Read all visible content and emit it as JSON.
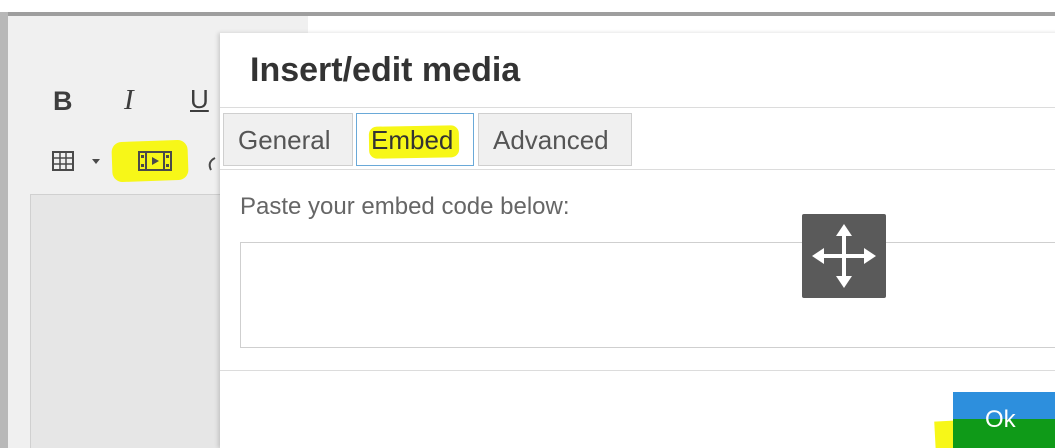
{
  "editor": {
    "toolbar": {
      "bold_label": "B",
      "italic_label": "I",
      "underline_label": "U"
    },
    "icons": {
      "bold": "bold-icon",
      "italic": "italic-icon",
      "underline": "underline-icon",
      "table": "table-grid-icon",
      "media": "film-strip-icon",
      "link": "link-icon"
    }
  },
  "dialog": {
    "title": "Insert/edit media",
    "tabs": [
      {
        "label": "General",
        "active": false
      },
      {
        "label": "Embed",
        "active": true
      },
      {
        "label": "Advanced",
        "active": false
      }
    ],
    "embed": {
      "label": "Paste your embed code below:",
      "value": ""
    },
    "move_handle_icon": "move-arrows-icon",
    "ok_label": "Ok"
  },
  "colors": {
    "highlight": "#f7f718",
    "ok_button": "#2d8fdd",
    "ok_highlight": "#0f9a18",
    "active_tab_border": "#6aa9d8",
    "move_handle": "#5a5a5a"
  }
}
